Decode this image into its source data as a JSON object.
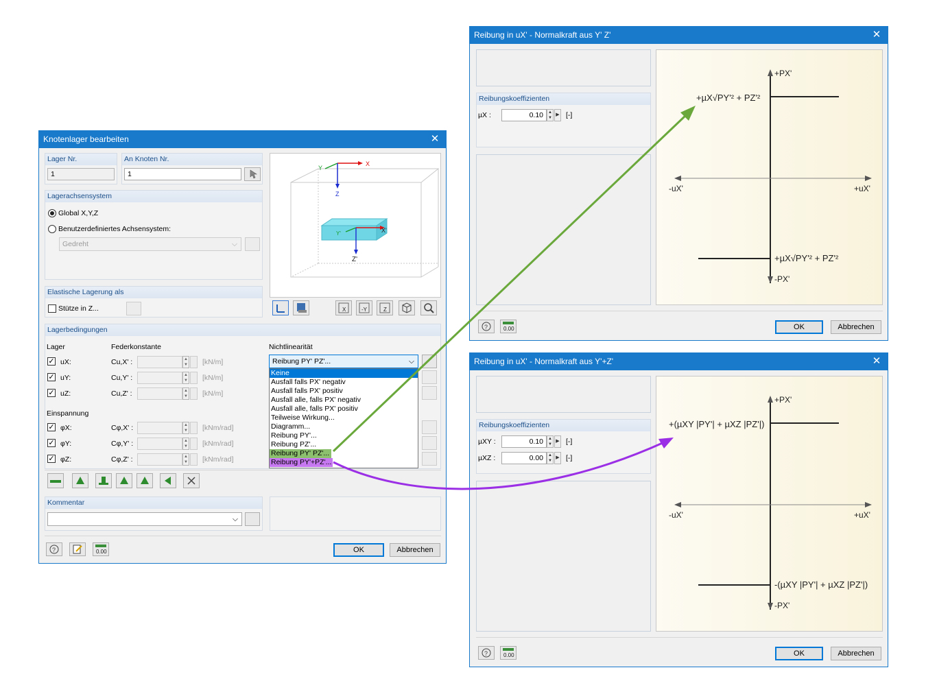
{
  "main": {
    "title": "Knotenlager bearbeiten",
    "lager_nr_label": "Lager Nr.",
    "lager_nr_value": "1",
    "an_knoten_label": "An Knoten Nr.",
    "an_knoten_value": "1",
    "achsen_title": "Lagerachsensystem",
    "radio_global": "Global X,Y,Z",
    "radio_user": "Benutzerdefiniertes Achsensystem:",
    "gedreht": "Gedreht",
    "elastisch_title": "Elastische Lagerung als",
    "stuetze": "Stütze in Z...",
    "bedingungen_title": "Lagerbedingungen",
    "col_lager": "Lager",
    "col_feder": "Federkonstante",
    "col_nonlin": "Nichtlinearität",
    "rows": [
      {
        "dof": "uX:",
        "feder": "Cu,X' :",
        "unit": "[kN/m]"
      },
      {
        "dof": "uY:",
        "feder": "Cu,Y' :",
        "unit": "[kN/m]"
      },
      {
        "dof": "uZ:",
        "feder": "Cu,Z' :",
        "unit": "[kN/m]"
      }
    ],
    "einspannung": "Einspannung",
    "rows2": [
      {
        "dof": "φX:",
        "feder": "Cφ,X' :",
        "unit": "[kNm/rad]"
      },
      {
        "dof": "φY:",
        "feder": "Cφ,Y' :",
        "unit": "[kNm/rad]"
      },
      {
        "dof": "φZ:",
        "feder": "Cφ,Z' :",
        "unit": "[kNm/rad]"
      }
    ],
    "nonlin_selected": "Reibung PY' PZ'...",
    "dropdown_items": [
      "Keine",
      "Ausfall falls PX' negativ",
      "Ausfall falls PX' positiv",
      "Ausfall alle, falls PX' negativ",
      "Ausfall alle, falls PX' positiv",
      "Teilweise Wirkung...",
      "Diagramm...",
      "Reibung PY'...",
      "Reibung PZ'...",
      "Reibung PY' PZ'...",
      "Reibung PY'+PZ'..."
    ],
    "kommentar_title": "Kommentar",
    "ok": "OK",
    "abbrechen": "Abbrechen",
    "view_labels": {
      "x": "X",
      "y": "Y",
      "z": "Z",
      "xp": "X'",
      "yp": "Y'",
      "zp": "Z'"
    }
  },
  "dlg1": {
    "title": "Reibung in uX' - Normalkraft aus Y' Z'",
    "coeff_title": "Reibungskoeffizienten",
    "mu_label": "µX :",
    "mu_value": "0.10",
    "mu_unit": "[-]",
    "ok": "OK",
    "abbrechen": "Abbrechen",
    "plus_px": "+PX'",
    "minus_px": "-PX'",
    "minus_ux": "-uX'",
    "plus_ux": "+uX'",
    "top_formula": "+µX√PY'² + PZ'²",
    "bottom_formula": "+µX√PY'² + PZ'²"
  },
  "dlg2": {
    "title": "Reibung in uX' - Normalkraft aus Y'+Z'",
    "coeff_title": "Reibungskoeffizienten",
    "mu1_label": "µXY :",
    "mu1_value": "0.10",
    "mu2_label": "µXZ :",
    "mu2_value": "0.00",
    "mu_unit": "[-]",
    "ok": "OK",
    "abbrechen": "Abbrechen",
    "plus_px": "+PX'",
    "minus_px": "-PX'",
    "minus_ux": "-uX'",
    "plus_ux": "+uX'",
    "top_formula": "+(µXY |PY'| + µXZ |PZ'|)",
    "bottom_formula": "-(µXY |PY'| + µXZ |PZ'|)"
  },
  "colors": {
    "titlebar": "#1979ca",
    "arrow_green": "#6aa83c",
    "arrow_purple": "#9b2fe6"
  }
}
